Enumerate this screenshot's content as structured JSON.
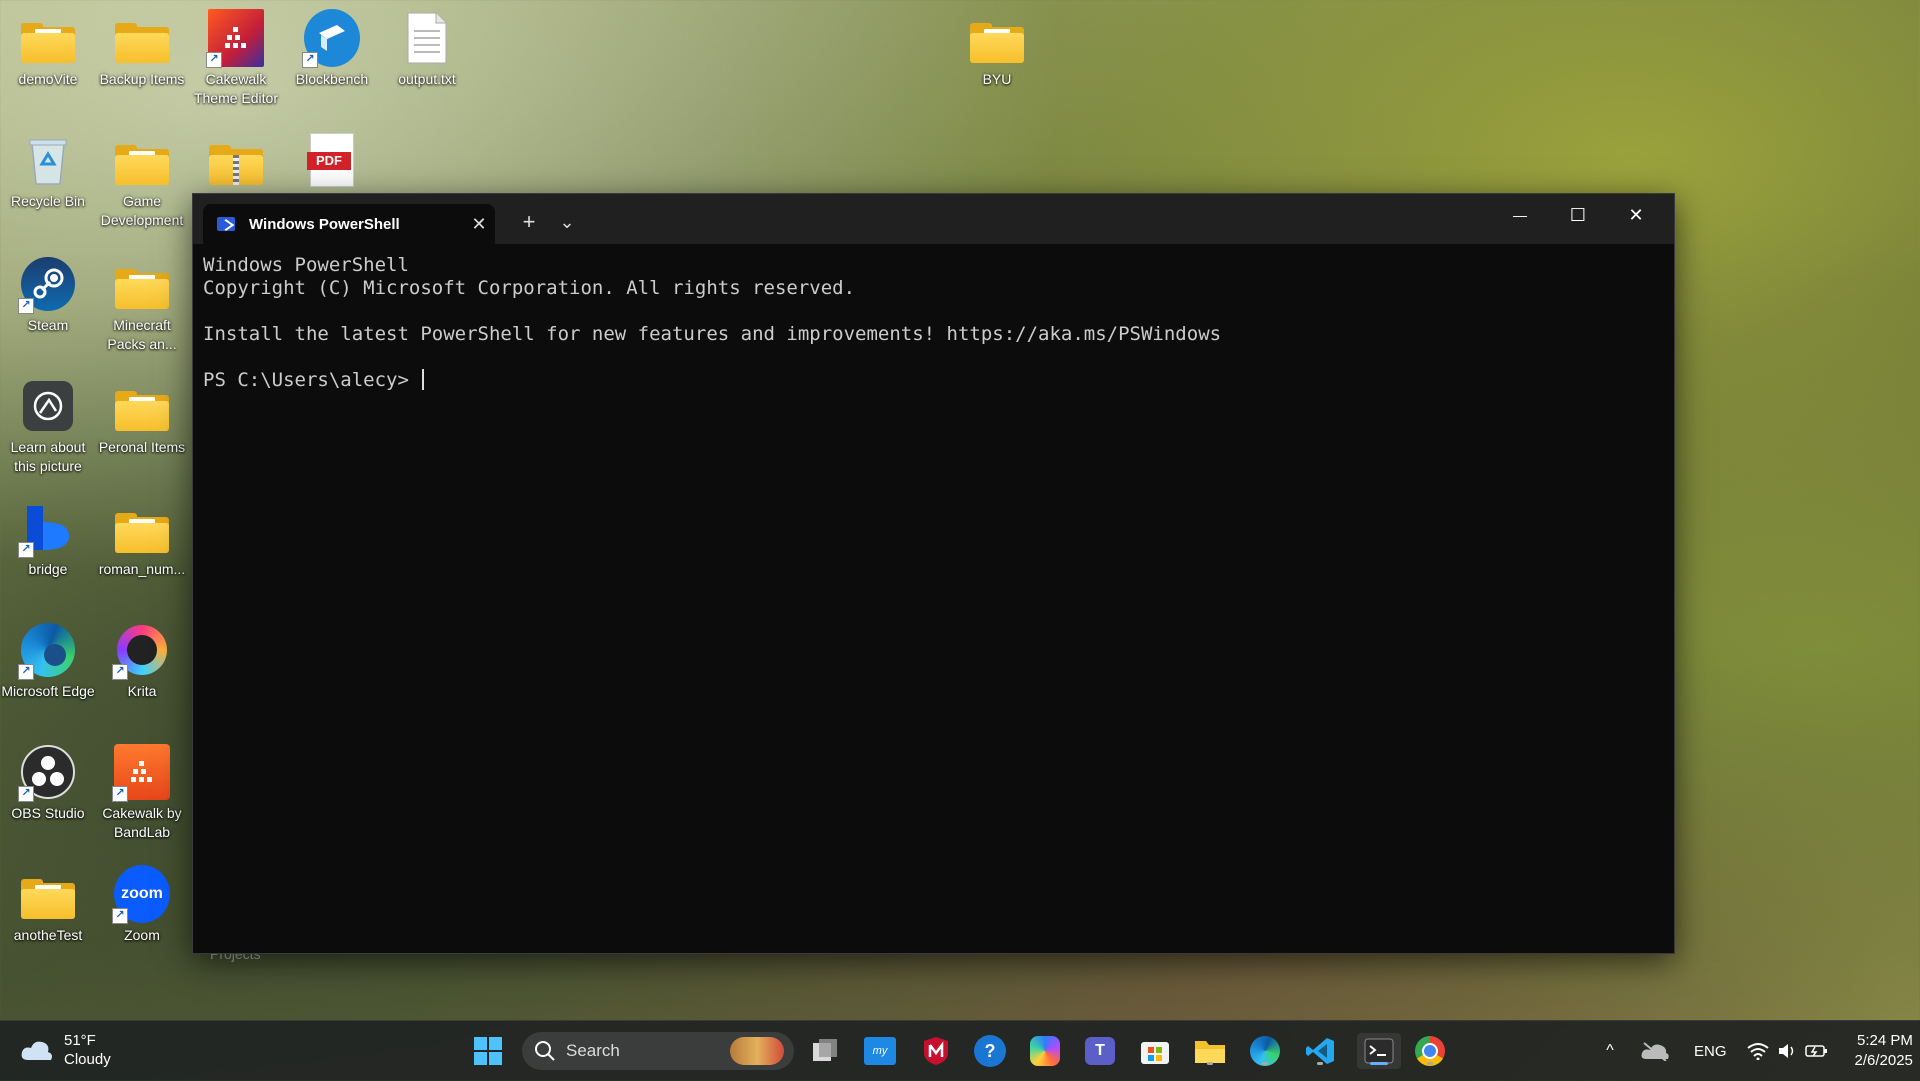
{
  "desktop": {
    "col1": [
      {
        "label": "demoVite",
        "kind": "folder"
      },
      {
        "label": "Recycle Bin",
        "kind": "recycle"
      },
      {
        "label": "Steam",
        "kind": "steam"
      },
      {
        "label": "Learn about this picture",
        "kind": "learn"
      },
      {
        "label": "bridge",
        "kind": "bridge"
      },
      {
        "label": "Microsoft Edge",
        "kind": "edge"
      },
      {
        "label": "OBS Studio",
        "kind": "obs"
      },
      {
        "label": "anotheTest",
        "kind": "folder"
      }
    ],
    "col2": [
      {
        "label": "Backup Items",
        "kind": "folder"
      },
      {
        "label": "Game Development",
        "kind": "folder"
      },
      {
        "label": "Minecraft Packs an...",
        "kind": "folder"
      },
      {
        "label": "Peronal Items",
        "kind": "folder"
      },
      {
        "label": "roman_num...",
        "kind": "folder"
      },
      {
        "label": "Krita",
        "kind": "krita"
      },
      {
        "label": "Cakewalk by BandLab",
        "kind": "cakewalk"
      },
      {
        "label": "Zoom",
        "kind": "zoom"
      }
    ],
    "top": [
      {
        "label": "Cakewalk Theme Editor",
        "kind": "cakewalk-theme"
      },
      {
        "label": "Blockbench",
        "kind": "blockbench"
      },
      {
        "label": "output.txt",
        "kind": "text"
      },
      {
        "label": "BYU",
        "kind": "folder"
      }
    ],
    "row2": [
      {
        "label": "",
        "kind": "zip"
      },
      {
        "label": "",
        "kind": "pdf"
      }
    ],
    "hidden_label": "Projects",
    "zoom_glyph": "zoom",
    "pdf_glyph": "PDF"
  },
  "terminal": {
    "tab_title": "Windows PowerShell",
    "tab_close": "✕",
    "new_tab": "+",
    "dropdown": "⌄",
    "minimize": "—",
    "maximize": "☐",
    "close": "✕",
    "lines": [
      "Windows PowerShell",
      "Copyright (C) Microsoft Corporation. All rights reserved.",
      "",
      "Install the latest PowerShell for new features and improvements! https://aka.ms/PSWindows",
      ""
    ],
    "prompt": "PS C:\\Users\\alecy> "
  },
  "taskbar": {
    "weather": {
      "temp": "51°F",
      "condition": "Cloudy"
    },
    "search_placeholder": "Search",
    "apps": [
      "start",
      "search",
      "task-view",
      "myhp",
      "mcafee",
      "hp-support",
      "copilot",
      "teams",
      "store",
      "file-explorer",
      "edge",
      "vscode",
      "terminal",
      "chrome"
    ],
    "active_app": "terminal",
    "tray": {
      "chevron": "^",
      "language": "ENG",
      "time": "5:24 PM",
      "date": "2/6/2025"
    }
  },
  "colors": {
    "terminal_bg": "#0c0c0c",
    "titlebar": "#202020",
    "accent": "#62b0ff",
    "folder": "#f6bf2c"
  }
}
